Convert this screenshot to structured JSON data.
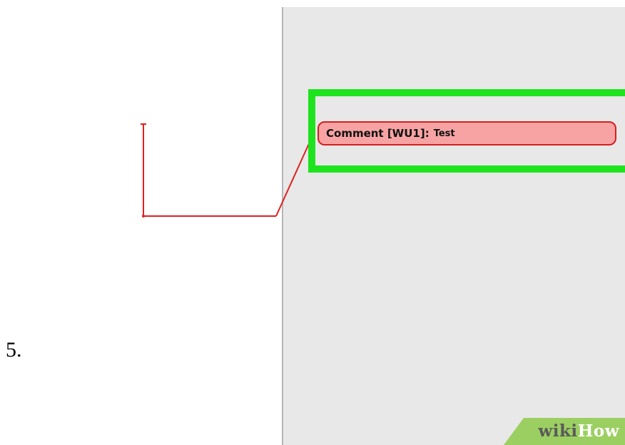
{
  "step": {
    "number": "5."
  },
  "comment": {
    "label": "Comment [WU1]:",
    "text": "Test",
    "fill_color": "#f7a3a3",
    "border_color": "#d42020"
  },
  "highlight": {
    "color": "#1ee31e"
  },
  "connector": {
    "color": "#e02020"
  },
  "markup_pane": {
    "background": "#e8e8e8"
  },
  "watermark": {
    "wiki": "wiki",
    "how": "How",
    "color": "#9ccf62"
  }
}
